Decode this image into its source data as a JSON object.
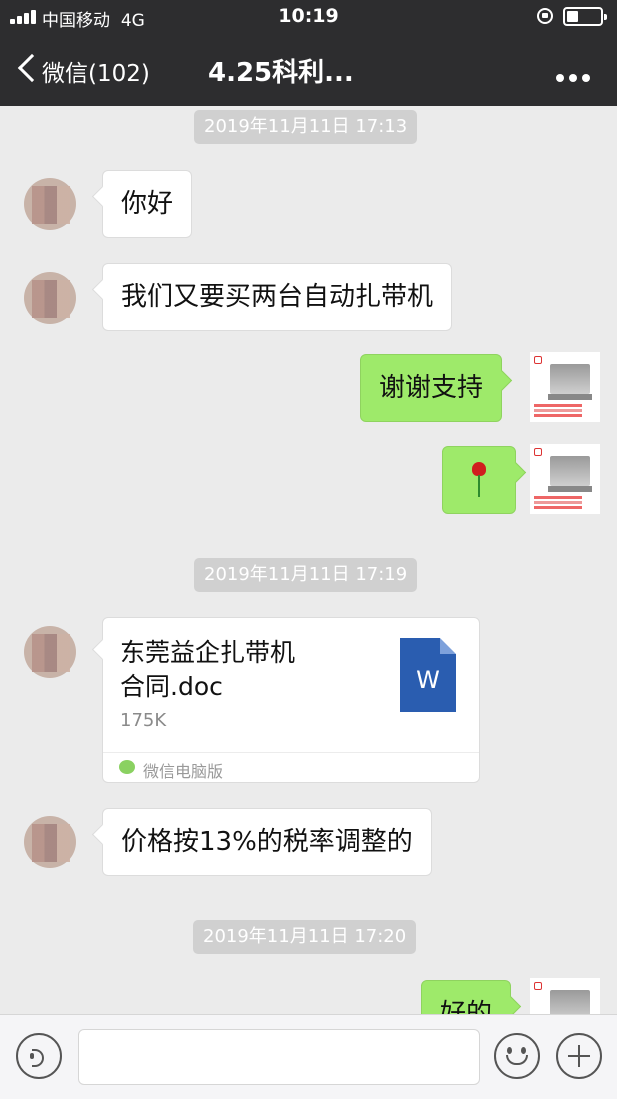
{
  "status_bar": {
    "carrier": "中国移动",
    "network": "4G",
    "time": "10:19"
  },
  "nav": {
    "back_label": "微信(102)",
    "title": "4.25科利..."
  },
  "timestamps": [
    "2019年11月11日 17:13",
    "2019年11月11日 17:19",
    "2019年11月11日 17:20"
  ],
  "messages": [
    {
      "side": "in",
      "text": "你好"
    },
    {
      "side": "in",
      "text": "我们又要买两台自动扎带机"
    },
    {
      "side": "out",
      "text": "谢谢支持"
    },
    {
      "side": "out",
      "sticker": "rose-emoji"
    },
    {
      "side": "in",
      "type": "file",
      "name": "东莞益企扎带机\n合同.doc",
      "size": "175K",
      "source": "微信电脑版",
      "icon": "word-doc-icon"
    },
    {
      "side": "in",
      "text": "价格按13%的税率调整的"
    },
    {
      "side": "out",
      "text": "好的"
    }
  ],
  "input_bar": {
    "placeholder": ""
  },
  "colors": {
    "nav_bg": "#2d2d2f",
    "chat_bg": "#ebebeb",
    "out_bubble": "#9eea6a",
    "in_bubble": "#ffffff"
  }
}
